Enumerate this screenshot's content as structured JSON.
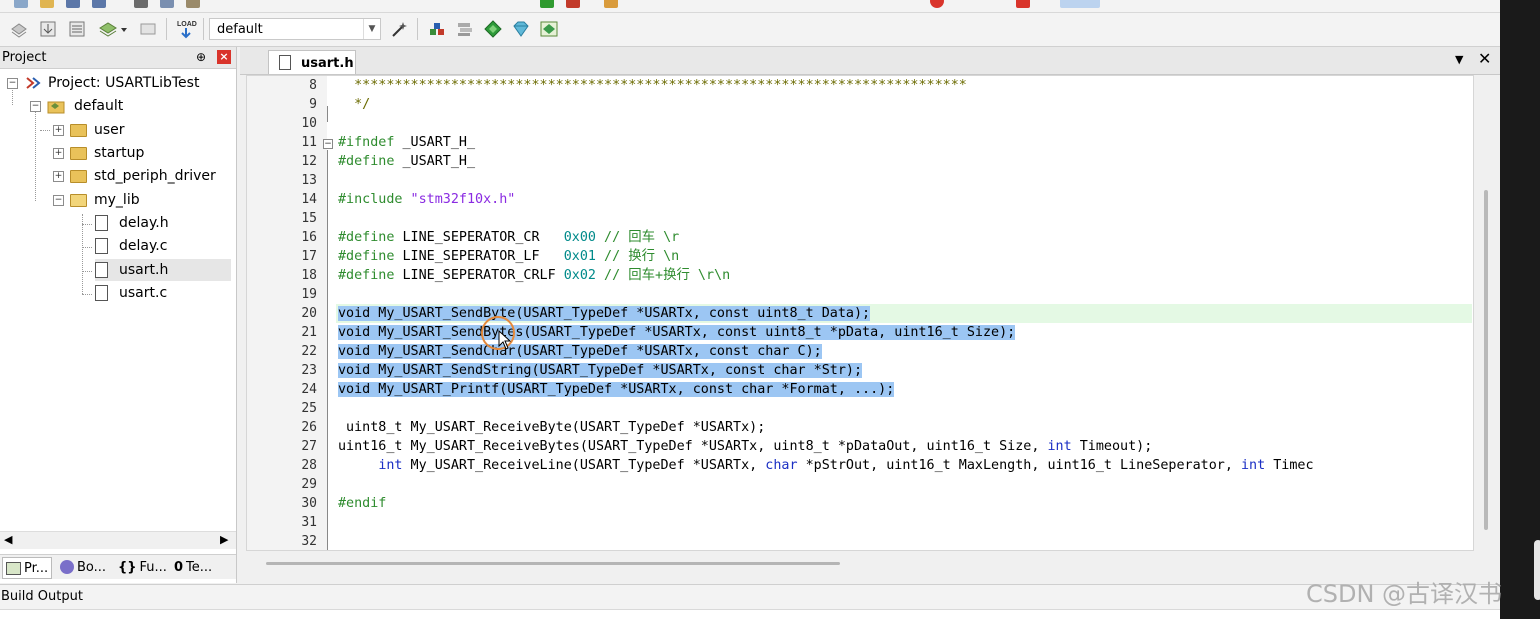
{
  "toolbar": {
    "target_value": "default",
    "icons": [
      "stack-icon",
      "download-icon",
      "batch-build-icon",
      "layers-icon",
      "translate-icon",
      "load-icon",
      "magic-wand-icon",
      "manage-components-icon",
      "pack-installer-icon",
      "diamond-icon",
      "gem-icon",
      "select-packs-icon"
    ],
    "load_label": "LOAD"
  },
  "project_panel": {
    "title": "Project",
    "pin_glyph": "⊕",
    "close_glyph": "×",
    "tree": {
      "project": "Project: USARTLibTest",
      "target": "default",
      "groups": [
        "user",
        "startup",
        "std_periph_driver",
        "my_lib"
      ],
      "files": [
        "delay.h",
        "delay.c",
        "usart.h",
        "usart.c"
      ]
    },
    "tabs": [
      "Pr...",
      "Bo...",
      "Fu...",
      "Te..."
    ]
  },
  "editor": {
    "tab_label": "usart.h",
    "menu_glyph": "▼",
    "close_glyph": "✕",
    "line_numbers": [
      "8",
      "9",
      "10",
      "11",
      "12",
      "13",
      "14",
      "15",
      "16",
      "17",
      "18",
      "19",
      "20",
      "21",
      "22",
      "23",
      "24",
      "25",
      "26",
      "27",
      "28",
      "29",
      "30",
      "31",
      "32"
    ],
    "code": {
      "l8": "  ****************************************************************************",
      "l9": "  */",
      "l11_kw": "#ifndef",
      "l11_rest": " _USART_H_",
      "l12_kw": "#define",
      "l12_rest": " _USART_H_",
      "l14_kw": "#include",
      "l14_str": " \"stm32f10x.h\"",
      "l16_kw": "#define",
      "l16_name": " LINE_SEPERATOR_CR   ",
      "l16_num": "0x00",
      "l16_cm": " // 回车 \\r",
      "l17_kw": "#define",
      "l17_name": " LINE_SEPERATOR_LF   ",
      "l17_num": "0x01",
      "l17_cm": " // 换行 \\n",
      "l18_kw": "#define",
      "l18_name": " LINE_SEPERATOR_CRLF ",
      "l18_num": "0x02",
      "l18_cm": " // 回车+换行 \\r\\n",
      "l20": "void My_USART_SendByte(USART_TypeDef *USARTx, const uint8_t Data);",
      "l21": "void My_USART_SendBytes(USART_TypeDef *USARTx, const uint8_t *pData, uint16_t Size);",
      "l22": "void My_USART_SendChar(USART_TypeDef *USARTx, const char C);",
      "l23": "void My_USART_SendString(USART_TypeDef *USARTx, const char *Str);",
      "l24": "void My_USART_Printf(USART_TypeDef *USARTx, const char *Format, ...);",
      "l26": " uint8_t My_USART_ReceiveByte(USART_TypeDef *USARTx);",
      "l27_a": "uint16_t My_USART_ReceiveBytes(USART_TypeDef *USARTx, uint8_t *pDataOut, uint16_t Size, ",
      "l27_kw": "int",
      "l27_b": " Timeout);",
      "l28_pre": "     ",
      "l28_kw1": "int",
      "l28_a": " My_USART_ReceiveLine(USART_TypeDef *USARTx, ",
      "l28_kw2": "char",
      "l28_b": " *pStrOut, uint16_t MaxLength, uint16_t LineSeperator, ",
      "l28_kw3": "int",
      "l28_c": " Timec",
      "l30_kw": "#endif"
    }
  },
  "build_output": {
    "title": "Build Output"
  },
  "watermark": "CSDN @古译汉书",
  "colors": {
    "selection": "#9cc6f3",
    "preprocessor": "#2f8c2f",
    "keyword": "#1b2fc4",
    "number": "#008a8a",
    "string": "#8a2be2"
  }
}
